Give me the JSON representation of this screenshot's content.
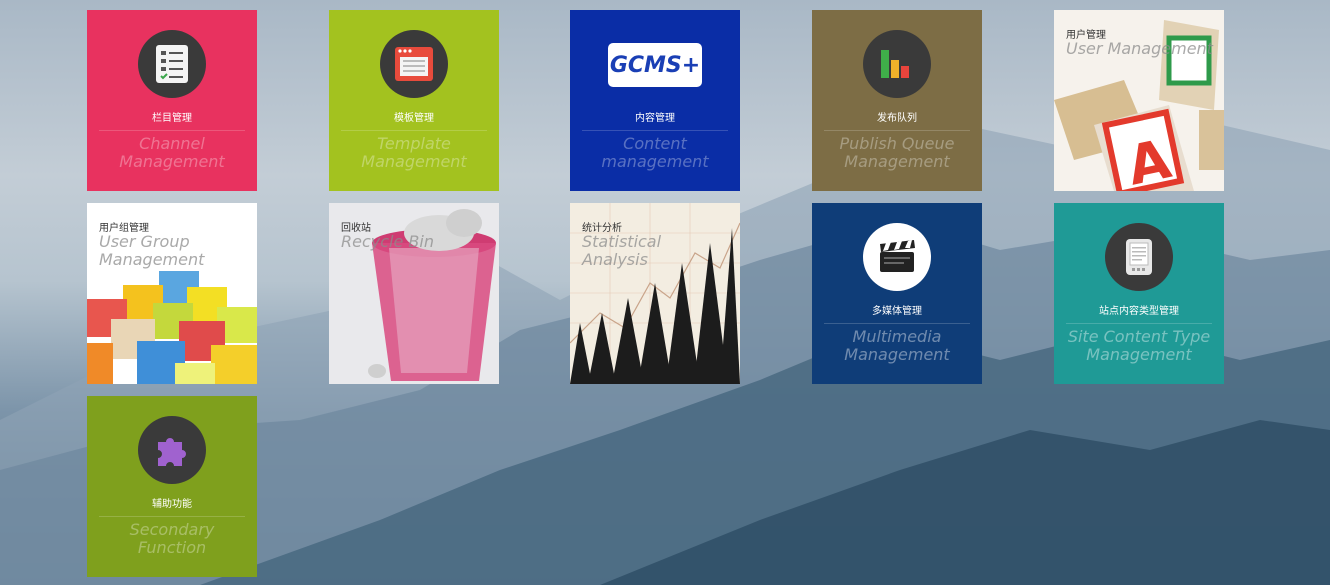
{
  "tiles": {
    "channel": {
      "cn": "栏目管理",
      "en1": "Channel",
      "en2": "Management",
      "color": "#e8325f"
    },
    "template": {
      "cn": "模板管理",
      "en1": "Template",
      "en2": "Management",
      "color": "#a3c21f"
    },
    "content": {
      "cn": "内容管理",
      "en1": "Content",
      "en2": "management",
      "color": "#0a2da6",
      "logo": "GCMS+"
    },
    "publish": {
      "cn": "发布队列",
      "en1": "Publish Queue",
      "en2": "Management",
      "color": "#7d6d45"
    },
    "user": {
      "cn": "用户管理",
      "en1": "User Management",
      "en2": ""
    },
    "user_group": {
      "cn": "用户组管理",
      "en1": "User Group",
      "en2": "Management"
    },
    "recycle": {
      "cn": "回收站",
      "en1": "Recycle Bin",
      "en2": ""
    },
    "statistics": {
      "cn": "统计分析",
      "en1": "Statistical",
      "en2": "Analysis"
    },
    "multimedia": {
      "cn": "多媒体管理",
      "en1": "Multimedia",
      "en2": "Management",
      "color": "#0f3d78"
    },
    "site_type": {
      "cn": "站点内容类型管理",
      "en1": "Site Content Type",
      "en2": "Management",
      "color": "#1f9a96"
    },
    "secondary": {
      "cn": "辅助功能",
      "en1": "Secondary",
      "en2": "Function",
      "color": "#7fa01d"
    }
  },
  "icons": [
    "checklist-icon",
    "template-window-icon",
    "gcms-logo-icon",
    "bar-chart-icon",
    "clapperboard-icon",
    "tablet-icon",
    "puzzle-icon"
  ]
}
